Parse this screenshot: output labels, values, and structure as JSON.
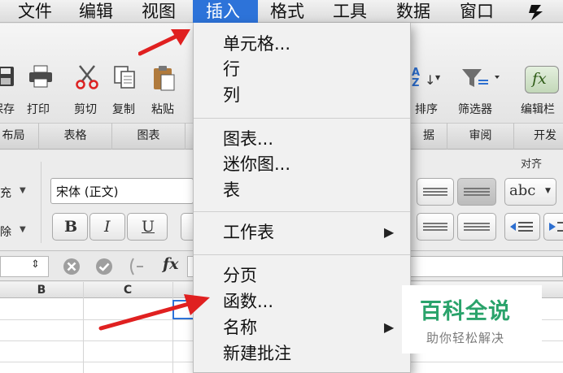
{
  "menubar": {
    "items": [
      {
        "label": "文件"
      },
      {
        "label": "编辑"
      },
      {
        "label": "视图"
      },
      {
        "label": "插入"
      },
      {
        "label": "格式"
      },
      {
        "label": "工具"
      },
      {
        "label": "数据"
      },
      {
        "label": "窗口"
      }
    ],
    "active_index": 3
  },
  "toolbar": {
    "labels": [
      "保存",
      "打印",
      "剪切",
      "复制",
      "粘贴",
      "排序",
      "筛选器",
      "编辑栏"
    ],
    "fx_symbol": "fx",
    "sort_glyph": "AZ"
  },
  "ribbon": {
    "tabs": [
      "布局",
      "表格",
      "图表",
      "据",
      "审阅",
      "开发"
    ],
    "group_align": "对齐",
    "font_name": "宋体 (正文)",
    "bold": "B",
    "italic": "I",
    "underline": "U",
    "left_label_1": "充",
    "left_label_2": "除",
    "wrap_label": "abc"
  },
  "formula_bar": {
    "fx_symbol": "fx"
  },
  "grid": {
    "columns": [
      "B",
      "C"
    ]
  },
  "insert_menu": {
    "items": [
      {
        "label": "单元格...",
        "submenu": false
      },
      {
        "label": "行",
        "submenu": false
      },
      {
        "label": "列",
        "submenu": false
      },
      {
        "label": "图表...",
        "submenu": false
      },
      {
        "label": "迷你图...",
        "submenu": false
      },
      {
        "label": "表",
        "submenu": false
      },
      {
        "label": "工作表",
        "submenu": true
      },
      {
        "label": "分页",
        "submenu": false
      },
      {
        "label": "函数...",
        "submenu": false
      },
      {
        "label": "名称",
        "submenu": true
      },
      {
        "label": "新建批注",
        "submenu": false
      }
    ],
    "arrow": "▶"
  },
  "watermark": {
    "title": "百科全说",
    "subtitle": "助你轻松解决"
  },
  "colors": {
    "accent": "#2d73d9",
    "arrow_red": "#e02020",
    "watermark_green": "#2aa36b"
  },
  "icons": [
    "save-icon",
    "print-icon",
    "scissors-icon",
    "copy-icon",
    "paste-icon",
    "sort-icon",
    "filter-icon",
    "formula-bar-icon",
    "chevron-down-icon",
    "cancel-icon",
    "confirm-icon",
    "arrow-right-icon"
  ]
}
